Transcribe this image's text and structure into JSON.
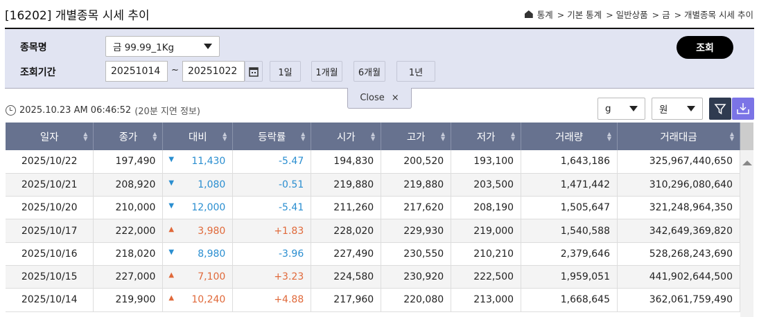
{
  "title": "[16202] 개별종목 시세 추이",
  "breadcrumb": [
    "통계",
    "> 기본 통계",
    "> 일반상품",
    "> 금",
    "> 개별종목 시세 추이"
  ],
  "filter": {
    "item_label": "종목명",
    "item_value": "금 99.99_1Kg",
    "period_label": "조회기간",
    "from": "20251014",
    "tilde": "~",
    "to": "20251022",
    "periods": [
      "1일",
      "1개월",
      "6개월",
      "1년"
    ],
    "search": "조회",
    "close": "Close"
  },
  "timestamp": "2025.10.23 AM 06:46:52",
  "delay": "(20분 지연 정보)",
  "unit": "g",
  "currency": "원",
  "colors": {
    "header": "#67728f",
    "down": "#2a8ed0",
    "up": "#e0693a"
  },
  "columns": [
    "일자",
    "종가",
    "대비",
    "등락률",
    "시가",
    "고가",
    "저가",
    "거래량",
    "거래대금"
  ],
  "rows": [
    {
      "date": "2025/10/22",
      "close": "197,490",
      "dir": "down",
      "chg": "11,430",
      "rate": "-5.47",
      "open": "194,830",
      "high": "200,520",
      "low": "193,100",
      "vol": "1,643,186",
      "amt": "325,967,440,650"
    },
    {
      "date": "2025/10/21",
      "close": "208,920",
      "dir": "down",
      "chg": "1,080",
      "rate": "-0.51",
      "open": "219,880",
      "high": "219,880",
      "low": "203,500",
      "vol": "1,471,442",
      "amt": "310,296,080,640"
    },
    {
      "date": "2025/10/20",
      "close": "210,000",
      "dir": "down",
      "chg": "12,000",
      "rate": "-5.41",
      "open": "211,260",
      "high": "217,620",
      "low": "208,190",
      "vol": "1,505,647",
      "amt": "321,248,964,350"
    },
    {
      "date": "2025/10/17",
      "close": "222,000",
      "dir": "up",
      "chg": "3,980",
      "rate": "+1.83",
      "open": "228,020",
      "high": "229,930",
      "low": "219,000",
      "vol": "1,540,588",
      "amt": "342,649,369,820"
    },
    {
      "date": "2025/10/16",
      "close": "218,020",
      "dir": "down",
      "chg": "8,980",
      "rate": "-3.96",
      "open": "227,490",
      "high": "230,550",
      "low": "210,210",
      "vol": "2,379,646",
      "amt": "528,268,243,690"
    },
    {
      "date": "2025/10/15",
      "close": "227,000",
      "dir": "up",
      "chg": "7,100",
      "rate": "+3.23",
      "open": "224,580",
      "high": "230,920",
      "low": "222,500",
      "vol": "1,959,051",
      "amt": "441,902,644,500"
    },
    {
      "date": "2025/10/14",
      "close": "219,900",
      "dir": "up",
      "chg": "10,240",
      "rate": "+4.88",
      "open": "217,960",
      "high": "220,080",
      "low": "213,000",
      "vol": "1,668,645",
      "amt": "362,061,759,490"
    }
  ]
}
